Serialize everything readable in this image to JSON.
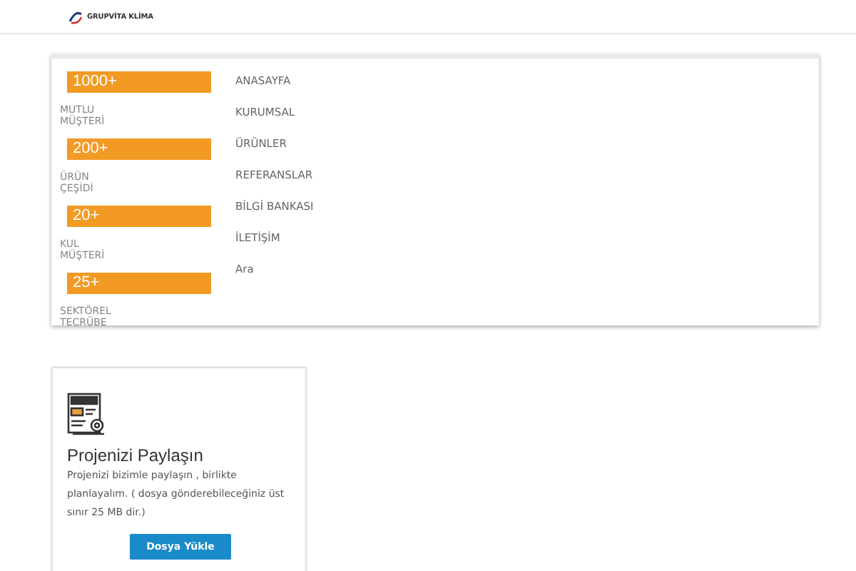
{
  "logo": {
    "text": "GRUPVİTA KLİMA"
  },
  "nav": [
    {
      "label": "ANASAYFA"
    },
    {
      "label": "KURUMSAL"
    },
    {
      "label": "ÜRÜNLER"
    },
    {
      "label": "REFERANSLAR"
    },
    {
      "label": "BİLGİ BANKASI"
    },
    {
      "label": "İLETİŞİM"
    },
    {
      "label": "Ara"
    }
  ],
  "stats": [
    {
      "value": "1000+",
      "label": "MUTLU MÜŞTERİ"
    },
    {
      "value": "200+",
      "label": "ÜRÜN ÇEŞİDİ"
    },
    {
      "value": "20+",
      "label": "KUL MÜŞTERİ"
    },
    {
      "value": "25+",
      "label": "SEKTÖREL TECRÜBE"
    }
  ],
  "upload_card": {
    "title": "Projenizi Paylaşın",
    "text": "Projenizi  bizimle paylaşın , birlikte planlayalım. ( dosya gönderebileceğiniz üst sınır 25 MB dir.)",
    "button": "Dosya Yükle"
  }
}
